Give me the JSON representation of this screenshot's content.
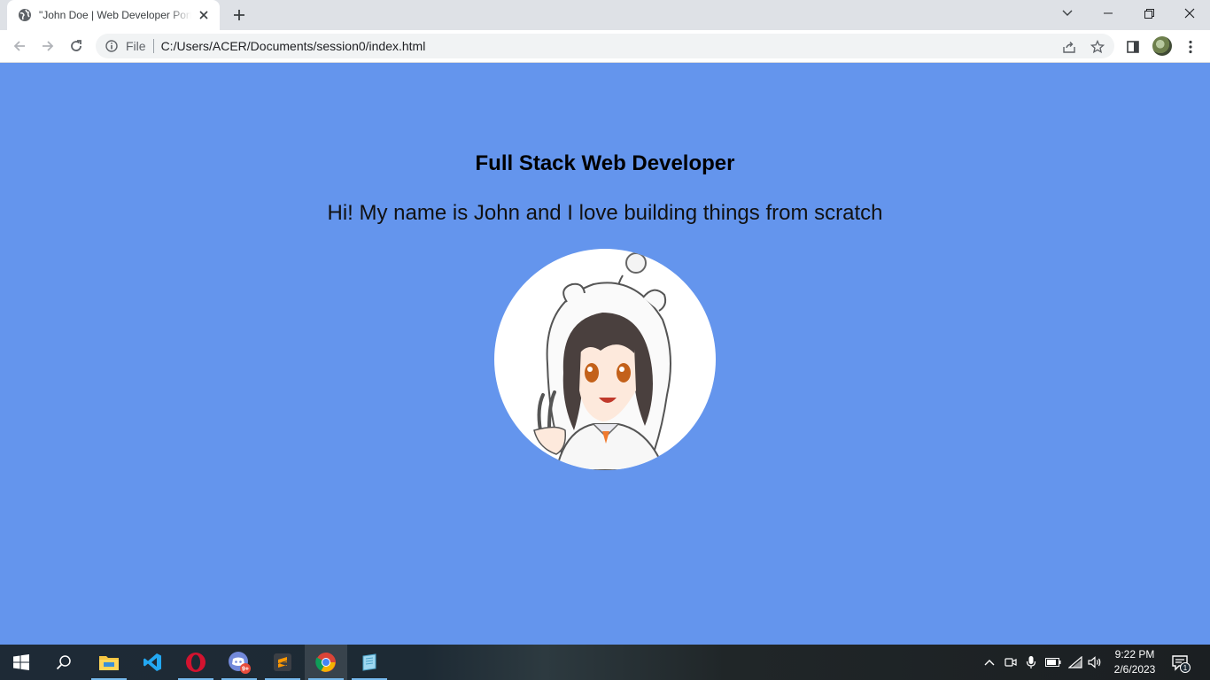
{
  "browser": {
    "tab_title": "\"John Doe | Web Developer Portfolio",
    "omnibox": {
      "scheme_label": "File",
      "url": "C:/Users/ACER/Documents/session0/index.html"
    }
  },
  "page": {
    "headline": "Full Stack Web Developer",
    "intro": "Hi! My name is John and I love building things from scratch",
    "avatar_description": "profile-avatar-illustration",
    "background_color": "#6495ED"
  },
  "taskbar": {
    "apps": [
      "start",
      "search",
      "file-explorer",
      "vscode",
      "opera",
      "discord",
      "sublime-text",
      "chrome",
      "notepad"
    ],
    "discord_badge": "9+",
    "clock_time": "9:22 PM",
    "clock_date": "2/6/2023",
    "notification_count": "1"
  }
}
